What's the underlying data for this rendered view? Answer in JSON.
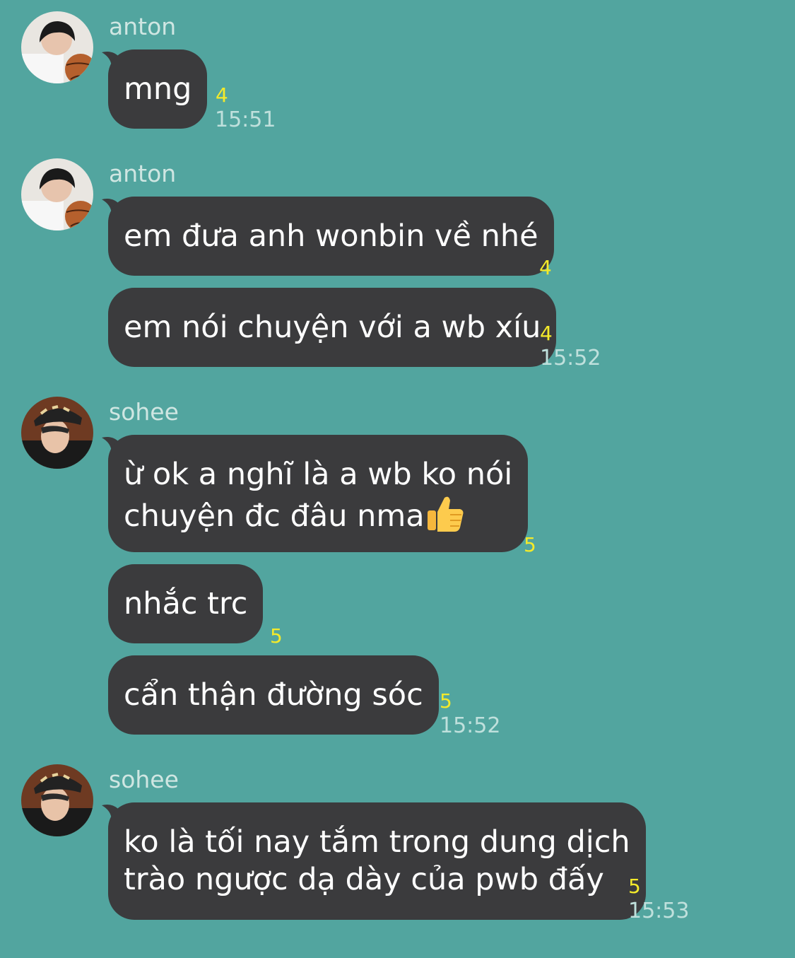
{
  "colors": {
    "background": "#52a59f",
    "bubble": "#3b3b3d",
    "read_count": "#f4ea2a",
    "timestamp": "#bfe0dc",
    "sender_name": "#cfe6e2"
  },
  "messages": [
    {
      "sender": "anton",
      "avatar_icon": "user-avatar-photo",
      "bubbles": [
        {
          "text": "mng",
          "read": "4"
        }
      ],
      "time": "15:51"
    },
    {
      "sender": "anton",
      "avatar_icon": "user-avatar-photo",
      "bubbles": [
        {
          "text": "em đưa anh wonbin về nhé",
          "read": "4"
        },
        {
          "text": "em nói chuyện với a wb xíu",
          "read": "4"
        }
      ],
      "time": "15:52"
    },
    {
      "sender": "sohee",
      "avatar_icon": "user-avatar-photo",
      "bubbles": [
        {
          "line1": "ừ ok a nghĩ là a wb ko nói",
          "line2": "chuyện đc đâu nma",
          "emoji": "thumbs-up-emoji",
          "read": "5"
        },
        {
          "text": "nhắc trc",
          "read": "5"
        },
        {
          "text": "cẩn thận đường sóc",
          "read": "5"
        }
      ],
      "time": "15:52"
    },
    {
      "sender": "sohee",
      "avatar_icon": "user-avatar-photo",
      "bubbles": [
        {
          "line1": "ko là tối nay tắm trong dung dịch",
          "line2": "trào ngược dạ dày của pwb đấy",
          "read": "5"
        }
      ],
      "time": "15:53"
    }
  ]
}
